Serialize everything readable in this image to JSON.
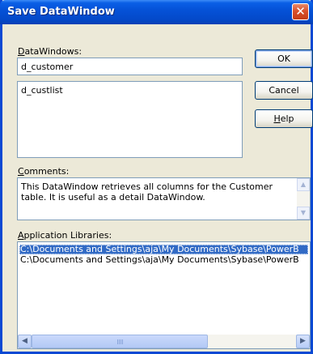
{
  "window": {
    "title": "Save DataWindow"
  },
  "datawindows": {
    "label_prefix": "",
    "label_accel": "D",
    "label_rest": "ataWindows:",
    "name_value": "d_customer",
    "list_items": [
      "d_custlist"
    ]
  },
  "buttons": {
    "ok": "OK",
    "cancel": "Cancel",
    "help_accel": "H",
    "help_rest": "elp"
  },
  "comments": {
    "label_accel": "C",
    "label_rest": "omments:",
    "text_line1": "This DataWindow retrieves all columns for the Customer",
    "text_line2": "table. It is useful as a detail DataWindow."
  },
  "libraries": {
    "label_accel": "A",
    "label_rest": "pplication Libraries:",
    "items": [
      "C:\\Documents and Settings\\aja\\My Documents\\Sybase\\PowerB",
      "C:\\Documents and Settings\\aja\\My Documents\\Sybase\\PowerB"
    ],
    "selected_index": 0
  },
  "icons": {
    "close": "close-icon",
    "scroll_up": "scroll-up-arrow-icon",
    "scroll_down": "scroll-down-arrow-icon",
    "scroll_left": "scroll-left-arrow-icon",
    "scroll_right": "scroll-right-arrow-icon"
  },
  "colors": {
    "title_blue": "#0552d8",
    "dialog_bg": "#ece9d8",
    "selection": "#316ac5",
    "close_red": "#d9502c"
  }
}
